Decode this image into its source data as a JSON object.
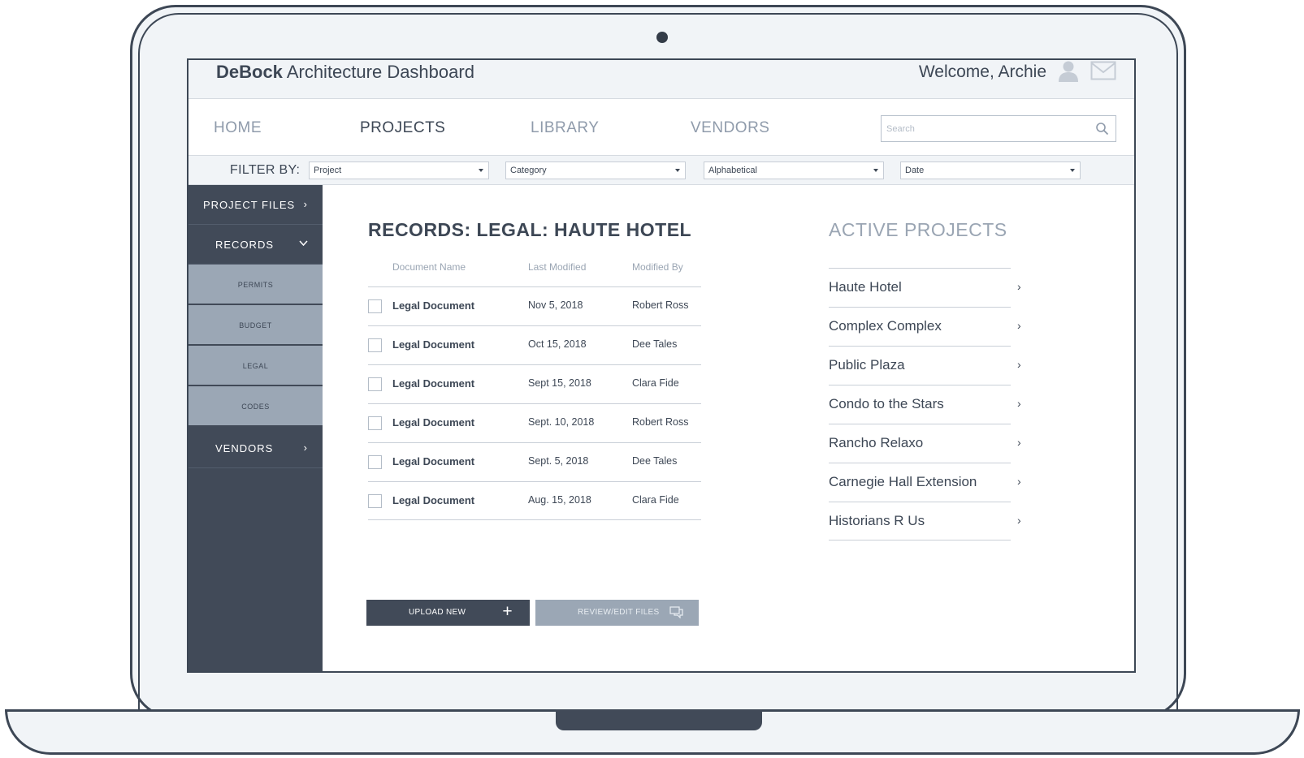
{
  "app": {
    "brand_bold": "DeBock",
    "brand_rest": " Architecture Dashboard",
    "welcome": "Welcome, Archie"
  },
  "nav": {
    "items": [
      {
        "label": "HOME",
        "active": false
      },
      {
        "label": "PROJECTS",
        "active": true
      },
      {
        "label": "LIBRARY",
        "active": false
      },
      {
        "label": "VENDORS",
        "active": false
      }
    ],
    "search_placeholder": "Search"
  },
  "filters": {
    "label": "FILTER BY:",
    "selects": [
      "Project",
      "Category",
      "Alphabetical",
      "Date"
    ]
  },
  "sidebar": {
    "project_files": "PROJECT FILES",
    "records": "RECORDS",
    "sub_items": [
      "PERMITS",
      "BUDGET",
      "LEGAL",
      "CODES"
    ],
    "vendors": "VENDORS"
  },
  "records": {
    "title": "RECORDS: LEGAL: HAUTE HOTEL",
    "columns": [
      "Document Name",
      "Last Modified",
      "Modified By"
    ],
    "rows": [
      {
        "name": "Legal Document",
        "date": "Nov 5, 2018",
        "by": "Robert Ross"
      },
      {
        "name": "Legal Document",
        "date": "Oct 15, 2018",
        "by": "Dee Tales"
      },
      {
        "name": "Legal Document",
        "date": "Sept 15, 2018",
        "by": "Clara Fide"
      },
      {
        "name": "Legal Document",
        "date": "Sept. 10, 2018",
        "by": "Robert Ross"
      },
      {
        "name": "Legal Document",
        "date": "Sept. 5, 2018",
        "by": "Dee Tales"
      },
      {
        "name": "Legal Document",
        "date": "Aug. 15, 2018",
        "by": "Clara Fide"
      }
    ],
    "upload_label": "UPLOAD NEW",
    "review_label": "REVIEW/EDIT FILES"
  },
  "active_projects": {
    "title": "ACTIVE PROJECTS",
    "items": [
      "Haute Hotel",
      "Complex Complex",
      "Public Plaza",
      "Condo to the Stars",
      "Rancho Relaxo",
      "Carnegie Hall Extension",
      "Historians R Us"
    ]
  },
  "icons": {
    "user": "user-icon",
    "mail": "mail-icon",
    "search": "search-icon",
    "plus": "plus-icon",
    "comment": "comment-icon",
    "chevron_right": "chevron-right-icon",
    "chevron_down": "chevron-down-icon"
  },
  "colors": {
    "primary": "#414a58",
    "muted": "#9ba7b5",
    "background": "#f1f4f7"
  }
}
